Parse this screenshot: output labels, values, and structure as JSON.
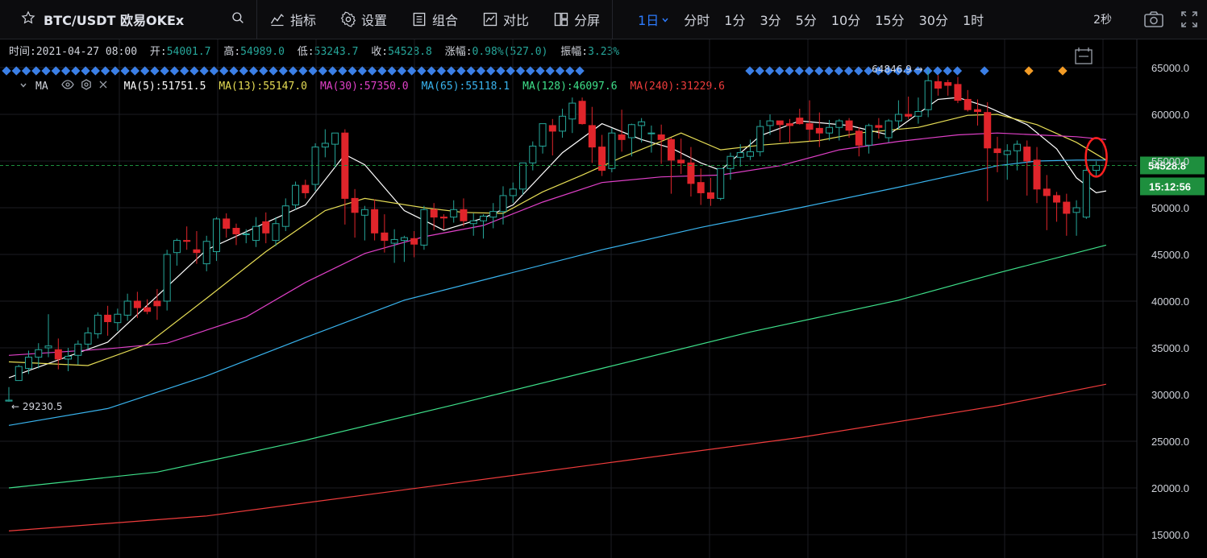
{
  "toolbar": {
    "symbol_title": "BTC/USDT 欧易OKEx",
    "indicators_label": "指标",
    "settings_label": "设置",
    "combine_label": "组合",
    "compare_label": "对比",
    "split_label": "分屏",
    "intervals": {
      "active": "1日",
      "i_tick": "分时",
      "i_1m": "1分",
      "i_3m": "3分",
      "i_5m": "5分",
      "i_10m": "10分",
      "i_15m": "15分",
      "i_30m": "30分",
      "i_1h": "1时"
    },
    "refresh": "2秒"
  },
  "ohlc": {
    "time_label": "时间:",
    "time": "2021-04-27 08:00",
    "open_label": "开:",
    "open": "54001.7",
    "high_label": "高:",
    "high": "54989.0",
    "low_label": "低:",
    "low": "53243.7",
    "close_label": "收:",
    "close": "54528.8",
    "change_label": "涨幅:",
    "change": "0.98%(527.0)",
    "amplitude_label": "振幅:",
    "amplitude": "3.23%"
  },
  "ma_legend": {
    "name": "MA",
    "items": [
      {
        "text": "MA(5):51751.5",
        "color": "#ffffff"
      },
      {
        "text": "MA(13):55147.0",
        "color": "#e6dd55"
      },
      {
        "text": "MA(30):57350.0",
        "color": "#e040c8"
      },
      {
        "text": "MA(65):55118.1",
        "color": "#39b4ef"
      },
      {
        "text": "MA(128):46097.6",
        "color": "#3ee08a"
      },
      {
        "text": "MA(240):31229.6",
        "color": "#f03c3c"
      }
    ]
  },
  "colors": {
    "up": "#26a69a",
    "up_fill": "#000000",
    "down": "#e0252b",
    "grid": "#1b1d22",
    "accent": "#2d7cff",
    "price_tag": "#1e8f3e",
    "annotation": "#ff2020",
    "marker_blue": "#3b7fe6",
    "marker_orange": "#f39c26"
  },
  "chart_data": {
    "type": "candlestick",
    "ylim": [
      13000,
      66500
    ],
    "y_ticks": [
      "65000.0",
      "60000.0",
      "55000.0",
      "50000.0",
      "45000.0",
      "40000.0",
      "35000.0",
      "30000.0",
      "25000.0",
      "20000.0",
      "15000.0"
    ],
    "last_price": "54528.8",
    "countdown": "15:12:56",
    "max_label": "64846.9",
    "min_label": "29230.5",
    "candles": [
      [
        29300,
        30800,
        29230,
        29400
      ],
      [
        31500,
        33200,
        31500,
        33000
      ],
      [
        32800,
        34700,
        32200,
        34000
      ],
      [
        34000,
        35500,
        32800,
        34800
      ],
      [
        35000,
        38600,
        34000,
        35200
      ],
      [
        34800,
        36000,
        32700,
        33800
      ],
      [
        33800,
        35000,
        32500,
        34100
      ],
      [
        34200,
        35800,
        33200,
        35400
      ],
      [
        35400,
        37200,
        34800,
        36600
      ],
      [
        36500,
        38800,
        36000,
        38500
      ],
      [
        38500,
        39500,
        36300,
        37800
      ],
      [
        37700,
        39200,
        36800,
        38600
      ],
      [
        38500,
        40800,
        37900,
        40000
      ],
      [
        40000,
        41000,
        38200,
        39300
      ],
      [
        39300,
        40200,
        38600,
        38900
      ],
      [
        40000,
        41300,
        38000,
        39500
      ],
      [
        40000,
        45500,
        39000,
        45000
      ],
      [
        45200,
        46700,
        43800,
        46500
      ],
      [
        46500,
        48000,
        45500,
        46400
      ],
      [
        45500,
        47500,
        44000,
        45200
      ],
      [
        44000,
        47000,
        43200,
        46400
      ],
      [
        45300,
        49000,
        44300,
        48800
      ],
      [
        48800,
        49400,
        46800,
        47800
      ],
      [
        47800,
        48300,
        46000,
        47200
      ],
      [
        47200,
        47700,
        46200,
        47200
      ],
      [
        46500,
        49000,
        45800,
        48000
      ],
      [
        48500,
        49500,
        46200,
        47300
      ],
      [
        46500,
        49000,
        45900,
        48300
      ],
      [
        48000,
        51000,
        47500,
        50200
      ],
      [
        50300,
        52800,
        49800,
        52400
      ],
      [
        52400,
        53000,
        51000,
        51600
      ],
      [
        52500,
        56900,
        51800,
        56500
      ],
      [
        56500,
        58400,
        55400,
        56900
      ],
      [
        56800,
        57600,
        54300,
        58000
      ],
      [
        58000,
        58400,
        48200,
        51000
      ],
      [
        51000,
        52000,
        46800,
        49500
      ],
      [
        49200,
        50200,
        46500,
        49800
      ],
      [
        49800,
        50900,
        46500,
        47300
      ],
      [
        47300,
        49300,
        45200,
        46500
      ],
      [
        46200,
        47700,
        44100,
        46600
      ],
      [
        46500,
        47000,
        44200,
        46800
      ],
      [
        46700,
        47500,
        44700,
        46100
      ],
      [
        46000,
        50200,
        45500,
        49800
      ],
      [
        49800,
        50500,
        47600,
        49000
      ],
      [
        49000,
        49300,
        47700,
        48900
      ],
      [
        49000,
        50800,
        48400,
        49800
      ],
      [
        49800,
        51000,
        48000,
        48600
      ],
      [
        48300,
        49400,
        47000,
        48600
      ],
      [
        48600,
        49300,
        46700,
        49100
      ],
      [
        49000,
        50500,
        47800,
        49600
      ],
      [
        49600,
        52300,
        48200,
        51300
      ],
      [
        51300,
        52700,
        50500,
        52000
      ],
      [
        52000,
        54800,
        51400,
        54800
      ],
      [
        54800,
        57100,
        54000,
        56600
      ],
      [
        56600,
        59000,
        55800,
        59000
      ],
      [
        58800,
        59500,
        55600,
        58200
      ],
      [
        58200,
        60600,
        57500,
        59800
      ],
      [
        59500,
        61800,
        58000,
        61200
      ],
      [
        61400,
        61800,
        58900,
        59000
      ],
      [
        58800,
        60800,
        54800,
        56500
      ],
      [
        56500,
        57800,
        53400,
        54000
      ],
      [
        54200,
        58500,
        53800,
        58000
      ],
      [
        57800,
        60500,
        56000,
        57300
      ],
      [
        57500,
        59000,
        55500,
        58900
      ],
      [
        58800,
        59600,
        57000,
        59200
      ],
      [
        58000,
        58800,
        55900,
        58000
      ],
      [
        57800,
        58900,
        54700,
        57300
      ],
      [
        57300,
        57500,
        51500,
        55100
      ],
      [
        55100,
        57400,
        53600,
        54800
      ],
      [
        54800,
        56500,
        51200,
        52600
      ],
      [
        52700,
        54200,
        50300,
        51600
      ],
      [
        51600,
        53200,
        50200,
        51000
      ],
      [
        51000,
        54100,
        50800,
        54200
      ],
      [
        54200,
        55900,
        53000,
        55500
      ],
      [
        55400,
        56800,
        54400,
        55900
      ],
      [
        55500,
        57300,
        55100,
        56000
      ],
      [
        56000,
        59400,
        55500,
        58700
      ],
      [
        58800,
        60000,
        57800,
        59300
      ],
      [
        59300,
        59300,
        57100,
        58900
      ],
      [
        59000,
        59500,
        56900,
        58800
      ],
      [
        59600,
        60600,
        58900,
        59000
      ],
      [
        59000,
        61500,
        57100,
        58400
      ],
      [
        58500,
        60200,
        56500,
        58000
      ],
      [
        58000,
        59400,
        57200,
        58600
      ],
      [
        58600,
        59500,
        57200,
        59300
      ],
      [
        59300,
        59600,
        57500,
        58300
      ],
      [
        58200,
        58600,
        55500,
        56700
      ],
      [
        56700,
        59000,
        55800,
        58800
      ],
      [
        58800,
        59600,
        57400,
        58600
      ],
      [
        57500,
        59500,
        57000,
        59300
      ],
      [
        59300,
        61500,
        58400,
        60000
      ],
      [
        60000,
        61900,
        59500,
        59800
      ],
      [
        59800,
        61800,
        59000,
        60300
      ],
      [
        60500,
        64846.9,
        59700,
        63600
      ],
      [
        63500,
        64200,
        62000,
        62800
      ],
      [
        63400,
        63700,
        62000,
        63100
      ],
      [
        63200,
        64000,
        61200,
        61500
      ],
      [
        61600,
        62600,
        60300,
        60500
      ],
      [
        60500,
        61600,
        58800,
        60300
      ],
      [
        60200,
        61300,
        50700,
        56400
      ],
      [
        56300,
        57600,
        53800,
        55900
      ],
      [
        55700,
        56800,
        53000,
        56100
      ],
      [
        56100,
        57200,
        54000,
        56800
      ],
      [
        56500,
        57200,
        51300,
        55000
      ],
      [
        55100,
        56500,
        50500,
        52000
      ],
      [
        52000,
        53500,
        47600,
        51300
      ],
      [
        51300,
        51700,
        48500,
        50600
      ],
      [
        50600,
        51500,
        47000,
        49400
      ],
      [
        49500,
        50800,
        47000,
        50000
      ],
      [
        49000,
        54600,
        48800,
        54000
      ],
      [
        54001.7,
        54989.0,
        53243.7,
        54528.8
      ]
    ],
    "ma_series": [
      {
        "name": "MA(5)",
        "color": "#ffffff",
        "points": [
          [
            0,
            31800
          ],
          [
            10,
            35600
          ],
          [
            20,
            45500
          ],
          [
            26,
            48400
          ],
          [
            30,
            50300
          ],
          [
            34,
            55700
          ],
          [
            36,
            54600
          ],
          [
            40,
            49700
          ],
          [
            44,
            47600
          ],
          [
            48,
            48900
          ],
          [
            51,
            50300
          ],
          [
            56,
            55900
          ],
          [
            60,
            59000
          ],
          [
            64,
            57300
          ],
          [
            67,
            56400
          ],
          [
            70,
            54800
          ],
          [
            72,
            54000
          ],
          [
            76,
            57700
          ],
          [
            80,
            59300
          ],
          [
            85,
            58800
          ],
          [
            89,
            57800
          ],
          [
            94,
            61600
          ],
          [
            96,
            61800
          ],
          [
            99,
            60800
          ],
          [
            103,
            58900
          ],
          [
            106,
            56300
          ],
          [
            108,
            53200
          ],
          [
            110,
            51600
          ],
          [
            111,
            51800
          ]
        ]
      },
      {
        "name": "MA(13)",
        "color": "#e6dd55",
        "points": [
          [
            0,
            33500
          ],
          [
            8,
            33100
          ],
          [
            14,
            35400
          ],
          [
            20,
            40300
          ],
          [
            26,
            45300
          ],
          [
            32,
            49700
          ],
          [
            36,
            51000
          ],
          [
            42,
            50000
          ],
          [
            46,
            49500
          ],
          [
            50,
            49400
          ],
          [
            54,
            51700
          ],
          [
            58,
            53500
          ],
          [
            62,
            55400
          ],
          [
            66,
            57100
          ],
          [
            68,
            58000
          ],
          [
            72,
            56200
          ],
          [
            76,
            56700
          ],
          [
            82,
            57200
          ],
          [
            86,
            58000
          ],
          [
            92,
            58600
          ],
          [
            97,
            59900
          ],
          [
            100,
            60000
          ],
          [
            104,
            58900
          ],
          [
            108,
            57000
          ],
          [
            111,
            55100
          ]
        ]
      },
      {
        "name": "MA(30)",
        "color": "#e040c8",
        "points": [
          [
            0,
            34200
          ],
          [
            10,
            34900
          ],
          [
            16,
            35500
          ],
          [
            24,
            38300
          ],
          [
            30,
            42000
          ],
          [
            36,
            45100
          ],
          [
            42,
            46900
          ],
          [
            48,
            48100
          ],
          [
            54,
            50600
          ],
          [
            60,
            52700
          ],
          [
            66,
            53300
          ],
          [
            72,
            53500
          ],
          [
            78,
            54500
          ],
          [
            84,
            56200
          ],
          [
            90,
            57100
          ],
          [
            96,
            57800
          ],
          [
            100,
            58000
          ],
          [
            104,
            57800
          ],
          [
            108,
            57600
          ],
          [
            111,
            57300
          ]
        ]
      },
      {
        "name": "MA(65)",
        "color": "#39b4ef",
        "points": [
          [
            0,
            26700
          ],
          [
            10,
            28500
          ],
          [
            20,
            32000
          ],
          [
            30,
            36100
          ],
          [
            40,
            40100
          ],
          [
            50,
            42800
          ],
          [
            60,
            45500
          ],
          [
            70,
            47900
          ],
          [
            80,
            50000
          ],
          [
            90,
            52200
          ],
          [
            100,
            54500
          ],
          [
            104,
            55000
          ],
          [
            108,
            55100
          ],
          [
            111,
            55100
          ]
        ]
      },
      {
        "name": "MA(128)",
        "color": "#3ee08a",
        "points": [
          [
            0,
            20000
          ],
          [
            15,
            21700
          ],
          [
            30,
            25100
          ],
          [
            45,
            28900
          ],
          [
            60,
            32800
          ],
          [
            75,
            36700
          ],
          [
            90,
            40100
          ],
          [
            100,
            43000
          ],
          [
            111,
            46000
          ]
        ]
      },
      {
        "name": "MA(240)",
        "color": "#f03c3c",
        "points": [
          [
            0,
            15400
          ],
          [
            20,
            17000
          ],
          [
            40,
            19800
          ],
          [
            60,
            22600
          ],
          [
            80,
            25400
          ],
          [
            100,
            28800
          ],
          [
            111,
            31100
          ]
        ]
      }
    ]
  }
}
